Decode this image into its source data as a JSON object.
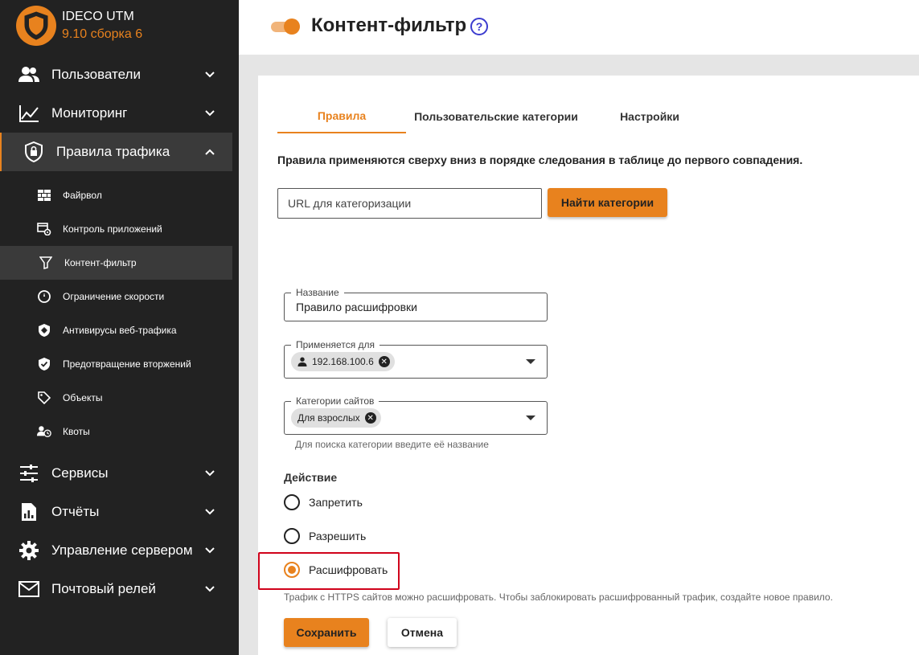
{
  "app": {
    "name": "IDECO UTM",
    "version": "9.10 сборка 6"
  },
  "sidebar": {
    "items": [
      {
        "label": "Пользователи",
        "icon": "users-icon"
      },
      {
        "label": "Мониторинг",
        "icon": "chart-line-icon"
      },
      {
        "label": "Правила трафика",
        "icon": "shield-lock-icon"
      },
      {
        "label": "Сервисы",
        "icon": "sliders-icon"
      },
      {
        "label": "Отчёты",
        "icon": "report-icon"
      },
      {
        "label": "Управление сервером",
        "icon": "gear-icon"
      },
      {
        "label": "Почтовый релей",
        "icon": "mail-icon"
      }
    ],
    "subitems": [
      {
        "label": "Файрвол",
        "icon": "firewall-icon"
      },
      {
        "label": "Контроль приложений",
        "icon": "app-control-icon"
      },
      {
        "label": "Контент-фильтр",
        "icon": "filter-icon"
      },
      {
        "label": "Ограничение скорости",
        "icon": "speed-icon"
      },
      {
        "label": "Антивирусы веб-трафика",
        "icon": "antivirus-icon"
      },
      {
        "label": "Предотвращение вторжений",
        "icon": "shield-check-icon"
      },
      {
        "label": "Объекты",
        "icon": "tag-icon"
      },
      {
        "label": "Квоты",
        "icon": "quota-icon"
      }
    ]
  },
  "header": {
    "title": "Контент-фильтр",
    "help": "?"
  },
  "tabs": [
    {
      "label": "Правила"
    },
    {
      "label": "Пользовательские категории"
    },
    {
      "label": "Настройки"
    }
  ],
  "main": {
    "hint": "Правила применяются сверху вниз в порядке следования в таблице до первого совпадения.",
    "url_placeholder": "URL для категоризации",
    "find_button": "Найти категории"
  },
  "form": {
    "name_label": "Название",
    "name_value": "Правило расшифровки",
    "applies_label": "Применяется для",
    "applies_chip": "192.168.100.6",
    "categories_label": "Категории сайтов",
    "categories_chip": "Для взрослых",
    "categories_helper": "Для поиска категории введите её название",
    "action_title": "Действие",
    "actions": [
      {
        "label": "Запретить",
        "checked": false
      },
      {
        "label": "Разрешить",
        "checked": false
      },
      {
        "label": "Расшифровать",
        "checked": true
      }
    ],
    "decrypt_helper": "Трафик с HTTPS сайтов можно расшифровать. Чтобы заблокировать расшифрованный трафик, создайте новое правило.",
    "save_button": "Сохранить",
    "cancel_button": "Отмена"
  },
  "colors": {
    "accent": "#e8821e",
    "sidebar_bg": "#222222",
    "highlight": "#d0021b",
    "help": "#3c3ccf"
  }
}
